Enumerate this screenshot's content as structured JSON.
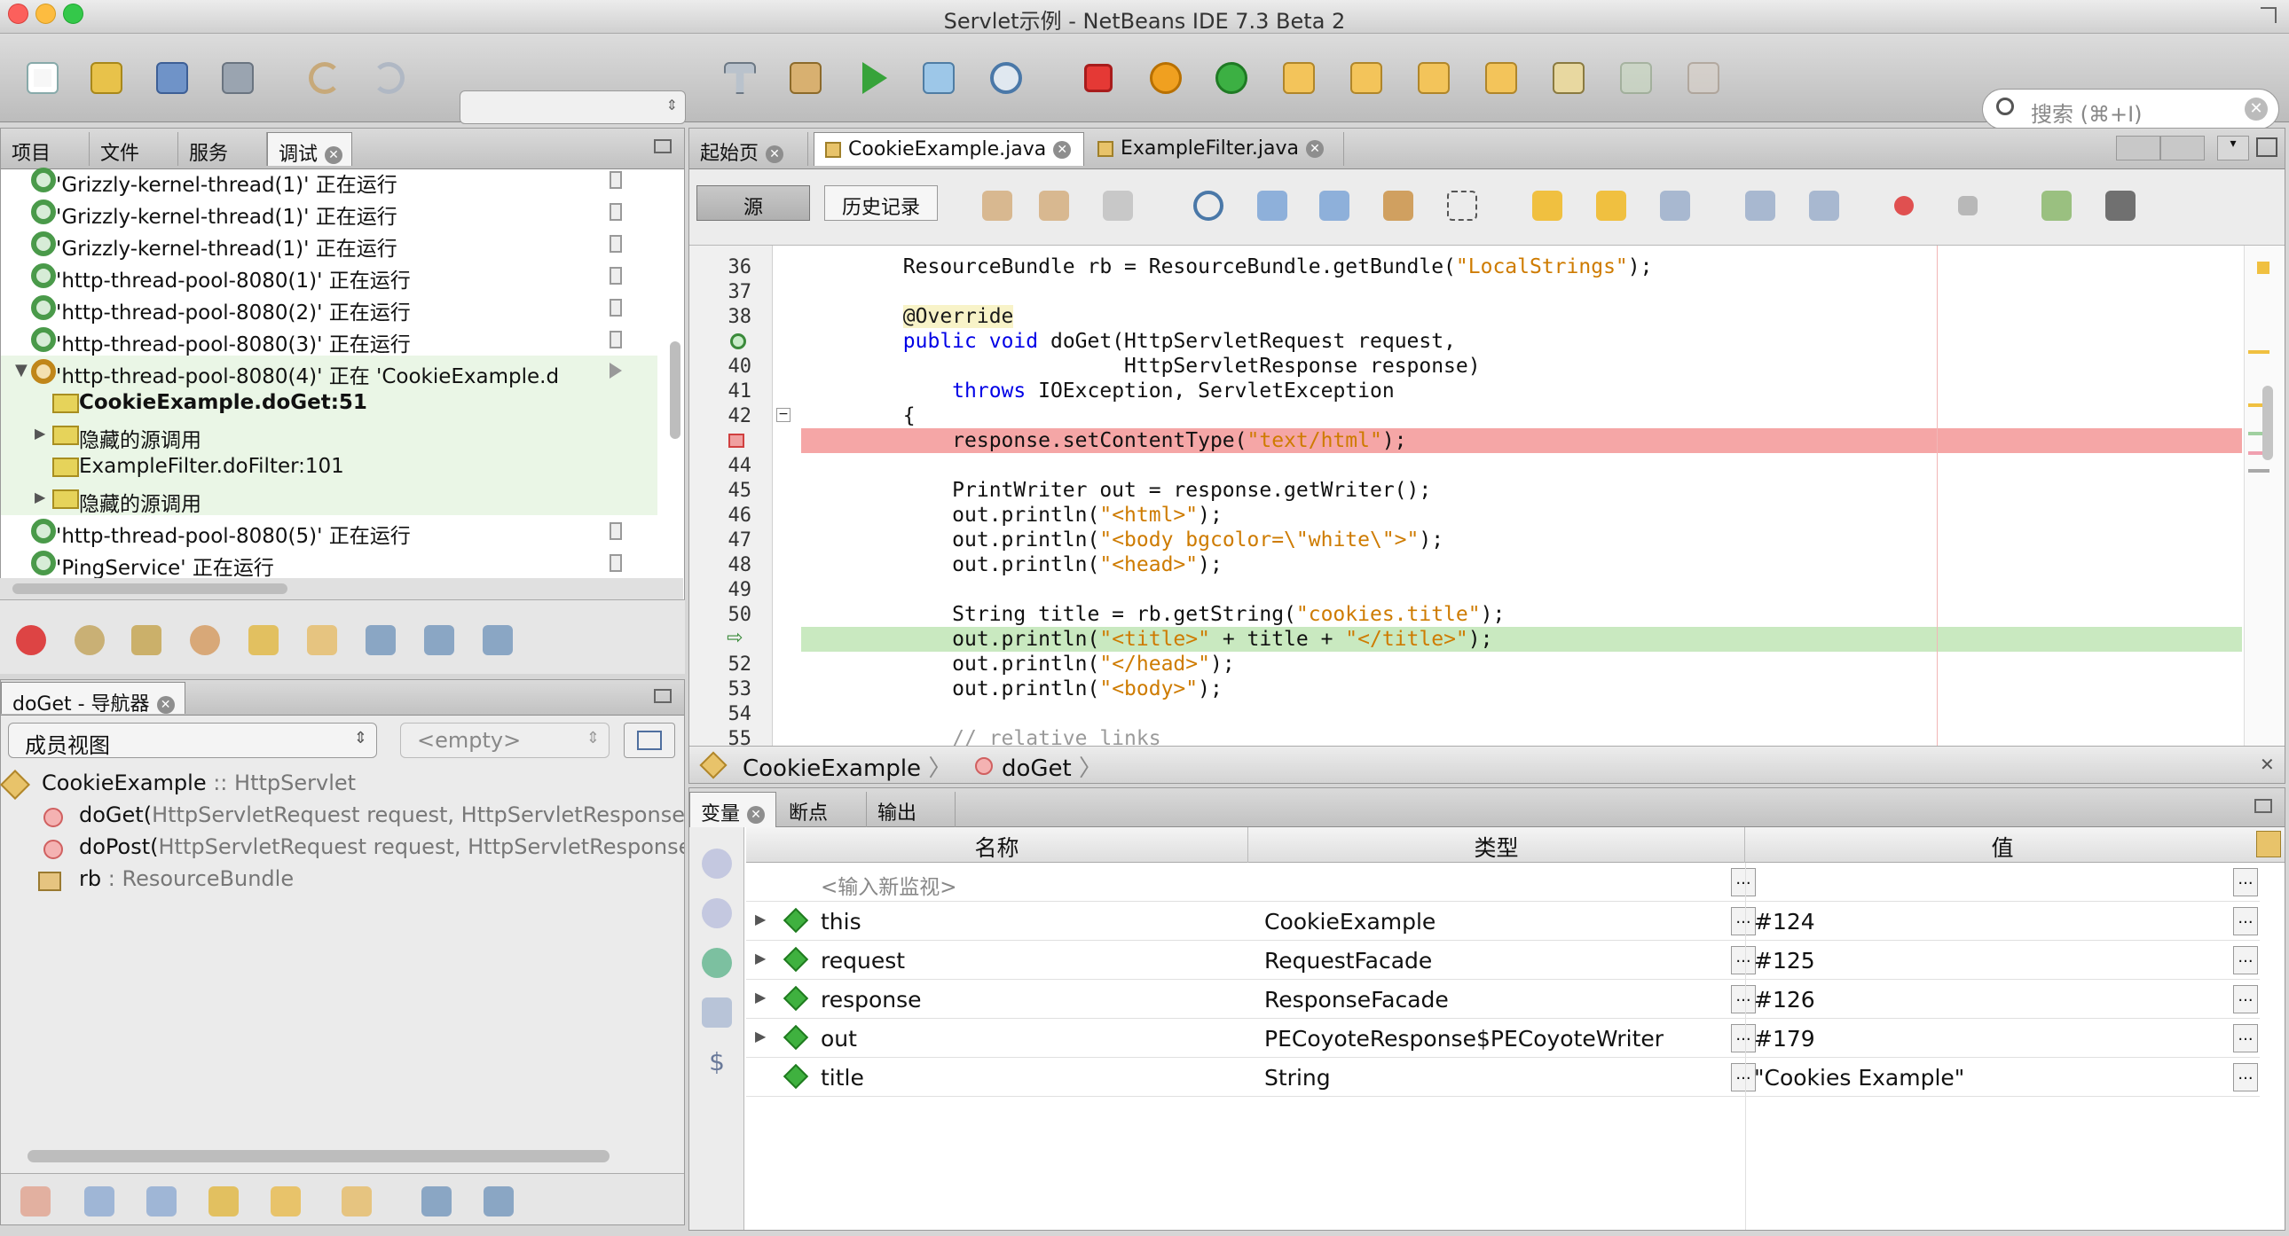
{
  "window": {
    "title": "Servlet示例 - NetBeans IDE 7.3 Beta 2"
  },
  "search": {
    "placeholder": "搜索 (⌘+I)"
  },
  "left_tabs": [
    "项目",
    "文件",
    "服务",
    "调试"
  ],
  "threads": [
    {
      "text": "'Grizzly-kernel-thread(1)' 正在运行",
      "kind": "thread"
    },
    {
      "text": "'Grizzly-kernel-thread(1)' 正在运行",
      "kind": "thread"
    },
    {
      "text": "'Grizzly-kernel-thread(1)' 正在运行",
      "kind": "thread"
    },
    {
      "text": "'http-thread-pool-8080(1)' 正在运行",
      "kind": "thread"
    },
    {
      "text": "'http-thread-pool-8080(2)' 正在运行",
      "kind": "thread"
    },
    {
      "text": "'http-thread-pool-8080(3)' 正在运行",
      "kind": "thread"
    },
    {
      "text": "'http-thread-pool-8080(4)' 正在 'CookieExample.d",
      "kind": "suspended"
    },
    {
      "text": "CookieExample.doGet:51",
      "kind": "frame-current"
    },
    {
      "text": "隐藏的源调用",
      "kind": "hidden"
    },
    {
      "text": "ExampleFilter.doFilter:101",
      "kind": "frame"
    },
    {
      "text": "隐藏的源调用",
      "kind": "hidden"
    },
    {
      "text": "'http-thread-pool-8080(5)' 正在运行",
      "kind": "thread"
    },
    {
      "text": "'PingService' 正在运行",
      "kind": "thread"
    }
  ],
  "navigator": {
    "title": "doGet - 导航器",
    "view_select": "成员视图",
    "filter_select": "<empty>",
    "class_name": "CookieExample",
    "class_super": ":: HttpServlet",
    "members": [
      {
        "name": "doGet(",
        "params": "HttpServletRequest request, HttpServletResponse res"
      },
      {
        "name": "doPost(",
        "params": "HttpServletRequest request, HttpServletResponse re"
      },
      {
        "name": "rb",
        "params": ": ResourceBundle"
      }
    ]
  },
  "editor_tabs": [
    "起始页",
    "CookieExample.java",
    "ExampleFilter.java"
  ],
  "editor_buttons": {
    "source": "源",
    "history": "历史记录"
  },
  "code_lines": [
    {
      "n": "36",
      "mark": "",
      "text": "        ResourceBundle rb = ResourceBundle.getBundle(\"LocalStrings\");"
    },
    {
      "n": "37",
      "mark": "",
      "text": ""
    },
    {
      "n": "38",
      "mark": "",
      "text": "        @Override"
    },
    {
      "n": "",
      "mark": "override",
      "text": "        public void doGet(HttpServletRequest request,"
    },
    {
      "n": "40",
      "mark": "",
      "text": "                          HttpServletResponse response)"
    },
    {
      "n": "41",
      "mark": "",
      "text": "            throws IOException, ServletException"
    },
    {
      "n": "42",
      "mark": "fold",
      "text": "        {"
    },
    {
      "n": "",
      "mark": "breakpoint",
      "text": "            response.setContentType(\"text/html\");"
    },
    {
      "n": "44",
      "mark": "",
      "text": ""
    },
    {
      "n": "45",
      "mark": "",
      "text": "            PrintWriter out = response.getWriter();"
    },
    {
      "n": "46",
      "mark": "",
      "text": "            out.println(\"<html>\");"
    },
    {
      "n": "47",
      "mark": "",
      "text": "            out.println(\"<body bgcolor=\\\"white\\\">\");"
    },
    {
      "n": "48",
      "mark": "",
      "text": "            out.println(\"<head>\");"
    },
    {
      "n": "49",
      "mark": "",
      "text": ""
    },
    {
      "n": "50",
      "mark": "",
      "text": "            String title = rb.getString(\"cookies.title\");"
    },
    {
      "n": "",
      "mark": "current",
      "text": "            out.println(\"<title>\" + title + \"</title>\");"
    },
    {
      "n": "52",
      "mark": "",
      "text": "            out.println(\"</head>\");"
    },
    {
      "n": "53",
      "mark": "",
      "text": "            out.println(\"<body>\");"
    },
    {
      "n": "54",
      "mark": "",
      "text": ""
    },
    {
      "n": "55",
      "mark": "",
      "text": "            // relative links"
    }
  ],
  "breadcrumb": [
    "CookieExample",
    "doGet"
  ],
  "bottom_tabs": [
    "变量",
    "断点",
    "输出"
  ],
  "variables": {
    "headers": [
      "名称",
      "类型",
      "值"
    ],
    "new_watch": "<输入新监视>",
    "rows": [
      {
        "name": "this",
        "type": "CookieExample",
        "value": "#124",
        "expandable": true
      },
      {
        "name": "request",
        "type": "RequestFacade",
        "value": "#125",
        "expandable": true
      },
      {
        "name": "response",
        "type": "ResponseFacade",
        "value": "#126",
        "expandable": true
      },
      {
        "name": "out",
        "type": "PECoyoteResponse$PECoyoteWriter",
        "value": "#179",
        "expandable": true
      },
      {
        "name": "title",
        "type": "String",
        "value": "\"Cookies Example\"",
        "expandable": false
      }
    ]
  },
  "colors": {
    "breakpoint_line": "#f5a6a6",
    "current_line": "#c9e9c0",
    "suspended_thread": "#eaf6e6"
  }
}
